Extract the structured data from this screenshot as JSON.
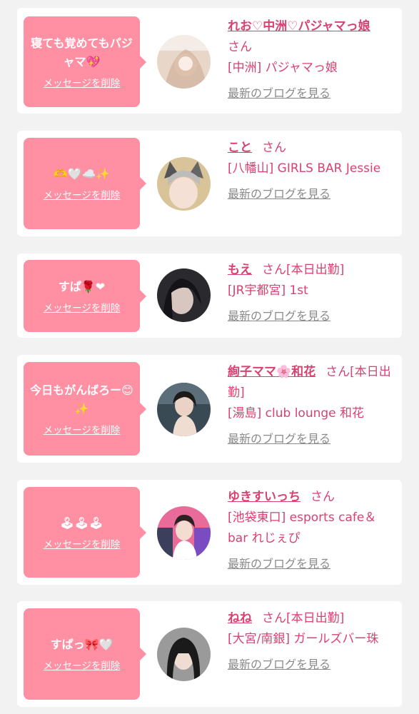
{
  "colors": {
    "accent": "#d94270",
    "bubble": "#ff8fa3",
    "link_gray": "#8a8a8a",
    "background": "#f2f2f2"
  },
  "delete_label": "メッセージを削除",
  "san_label": "さん",
  "blog_label": "最新のブログを見る",
  "items": [
    {
      "message": "寝ても覚めてもパジャマ💖",
      "name": "れお♡中洲♡パジャマっ娘",
      "status": "",
      "shop": "[中洲] パジャマっ娘"
    },
    {
      "message": "🫶🤍☁️✨",
      "name": "こと",
      "status": "",
      "shop": "[八幡山] GIRLS BAR Jessie"
    },
    {
      "message": "すぱ🌹❤",
      "name": "もえ",
      "status": "[本日出勤]",
      "shop": "[JR宇都宮] 1st"
    },
    {
      "message": "今日もがんばろー😊✨",
      "name": "絢子ママ🌸和花",
      "status": "[本日出勤]",
      "shop": "[湯島] club lounge 和花"
    },
    {
      "message": "🕹🕹🕹",
      "name": "ゆきすいっち",
      "status": "",
      "shop": "[池袋東口] esports cafe＆bar れじぇぴ"
    },
    {
      "message": "すぱっ🎀🤍",
      "name": "ねね",
      "status": "[本日出勤]",
      "shop": "[大宮/南銀] ガールズバー珠"
    }
  ]
}
